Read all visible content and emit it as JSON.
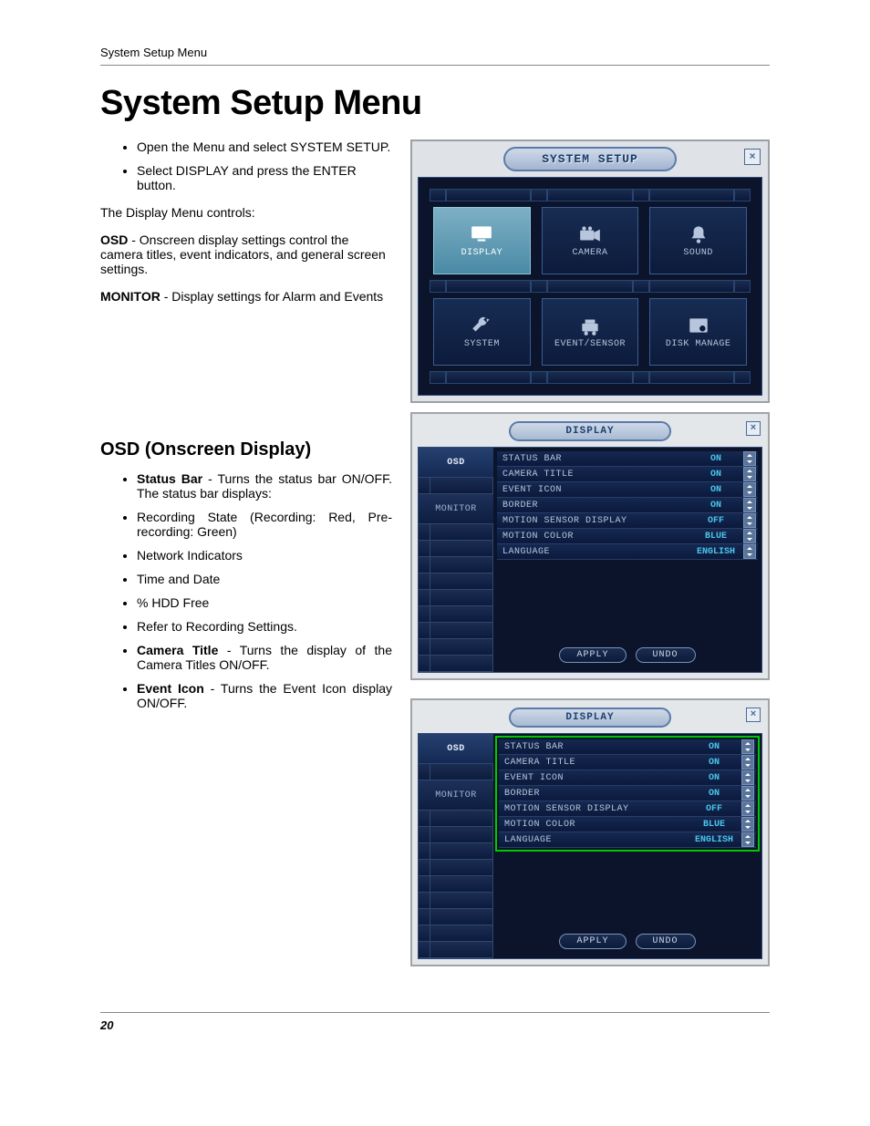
{
  "header": {
    "running": "System Setup Menu"
  },
  "title": "System Setup Menu",
  "intro": {
    "b1": "Open the Menu and select SYSTEM SETUP.",
    "b2": "Select DISPLAY and press the ENTER button.",
    "p1": "The Display Menu controls:",
    "p2a": "OSD",
    "p2b": " - Onscreen display settings control the camera titles, event indicators, and general screen settings.",
    "p3a": "MONITOR",
    "p3b": " - Display settings for Alarm and Events"
  },
  "osd_heading": "OSD (Onscreen Display)",
  "osd_bullets": {
    "b1a": "Status Bar",
    "b1b": " - Turns the status bar ON/OFF. The status bar displays:",
    "b2": "Recording State (Recording: Red, Pre-recording: Green)",
    "b3": "Network Indicators",
    "b4": "Time and Date",
    "b5": "% HDD Free",
    "b6": "Refer to Recording Settings.",
    "b7a": "Camera Title",
    "b7b": " - Turns the display of the Camera Titles ON/OFF.",
    "b8a": "Event Icon",
    "b8b": " - Turns the Event Icon display ON/OFF."
  },
  "setup_panel": {
    "title": "SYSTEM SETUP",
    "tiles": [
      {
        "label": "DISPLAY",
        "icon": "display-icon",
        "active": true
      },
      {
        "label": "CAMERA",
        "icon": "camera-icon"
      },
      {
        "label": "SOUND",
        "icon": "bell-icon"
      },
      {
        "label": "SYSTEM",
        "icon": "wrench-icon"
      },
      {
        "label": "EVENT/SENSOR",
        "icon": "sensor-icon"
      },
      {
        "label": "DISK MANAGE",
        "icon": "disk-icon"
      }
    ]
  },
  "display_panel": {
    "title": "DISPLAY",
    "tabs": {
      "osd": "OSD",
      "monitor": "MONITOR"
    },
    "rows": [
      {
        "label": "STATUS BAR",
        "value": "ON"
      },
      {
        "label": "CAMERA TITLE",
        "value": "ON"
      },
      {
        "label": "EVENT ICON",
        "value": "ON"
      },
      {
        "label": "BORDER",
        "value": "ON"
      },
      {
        "label": "MOTION SENSOR DISPLAY",
        "value": "OFF"
      },
      {
        "label": "MOTION COLOR",
        "value": "BLUE"
      },
      {
        "label": "LANGUAGE",
        "value": "ENGLISH"
      }
    ],
    "apply": "APPLY",
    "undo": "UNDO"
  },
  "page_number": "20"
}
